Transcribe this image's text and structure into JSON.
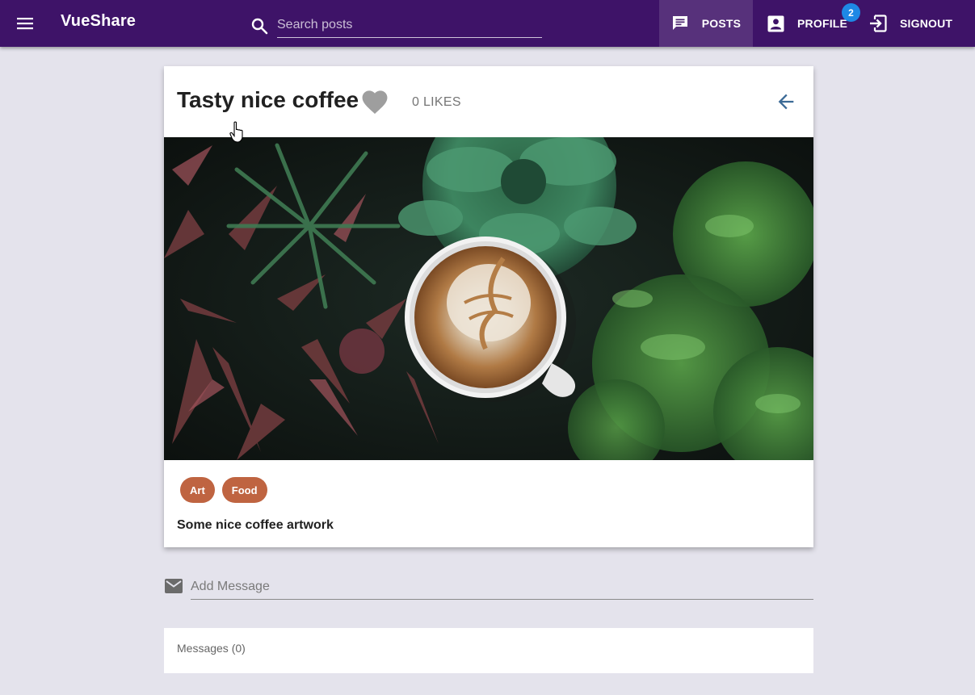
{
  "header": {
    "app_title": "VueShare",
    "search_placeholder": "Search posts",
    "nav": {
      "posts_label": "POSTS",
      "profile_label": "PROFILE",
      "profile_badge": "2",
      "signout_label": "SIGNOUT"
    }
  },
  "post": {
    "title": "Tasty nice coffee",
    "likes_label": "0 LIKES",
    "tags": [
      "Art",
      "Food"
    ],
    "description": "Some nice coffee artwork"
  },
  "message_form": {
    "placeholder": "Add Message"
  },
  "messages": {
    "label": "Messages (0)"
  },
  "colors": {
    "toolbar": "#3e1368",
    "chip": "#bf6441",
    "badge": "#1e88e5",
    "back_arrow": "#3b6a96",
    "background": "#e4e3ec"
  }
}
